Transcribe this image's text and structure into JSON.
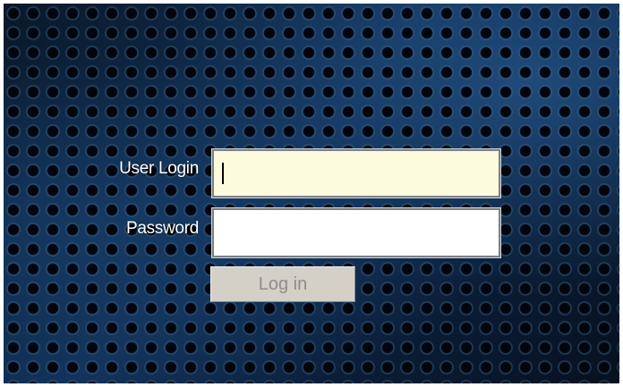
{
  "login_form": {
    "user_label": "User Login",
    "user_value": "",
    "password_label": "Password",
    "password_value": "",
    "login_button": "Log in",
    "login_button_enabled": false
  },
  "colors": {
    "user_field_background": "#fdfbdd",
    "password_field_background": "#ffffff",
    "button_background": "#d4d0c8",
    "button_text_disabled": "#8d8d8d",
    "label_text": "#ffffff"
  }
}
